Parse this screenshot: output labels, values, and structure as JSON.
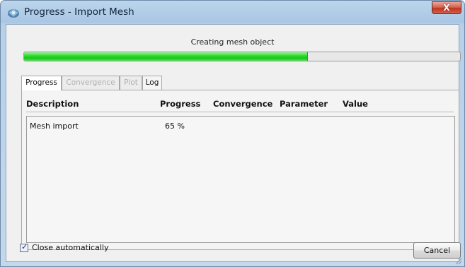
{
  "window": {
    "title": "Progress - Import Mesh",
    "close_glyph": "X"
  },
  "status": {
    "text": "Creating mesh object",
    "progress_fraction": 0.65,
    "bar_color": "#14c814"
  },
  "tabs": [
    {
      "label": "Progress",
      "active": true
    },
    {
      "label": "Convergence",
      "active": false
    },
    {
      "label": "Plot",
      "active": false
    },
    {
      "label": "Log",
      "active": false
    }
  ],
  "table": {
    "columns": [
      "Description",
      "Progress",
      "Convergence",
      "Parameter",
      "Value"
    ],
    "rows": [
      {
        "description": "Mesh import",
        "progress": "65 %",
        "convergence": "",
        "parameter": "",
        "value": ""
      }
    ]
  },
  "footer": {
    "close_automatically_label": "Close automatically",
    "close_automatically_checked": true,
    "check_glyph": "✓",
    "cancel_label": "Cancel"
  },
  "icons": {
    "app": "app-logo-icon",
    "close": "close-icon",
    "grip": "resize-grip-icon"
  }
}
